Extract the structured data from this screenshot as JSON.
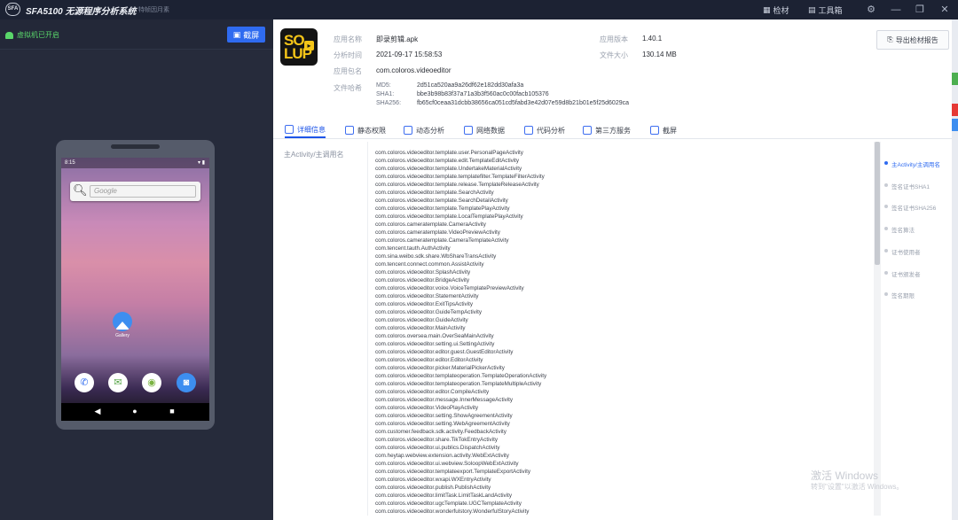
{
  "titlebar": {
    "logo_text": "SFA",
    "title": "SFA5100 无源程序分析系统",
    "subtitle": "特帧因月素",
    "btn_check": "检材",
    "btn_toolbox": "工具箱"
  },
  "emulator": {
    "status": "虚拟机已开启",
    "screenshot_btn": "截屏",
    "phone": {
      "time": "8:15",
      "search_placeholder": "Google",
      "gallery_label": "Gallery"
    }
  },
  "app_info": {
    "icon_text": "SO LUP",
    "name_label": "应用名称",
    "name": "即录剪辑.apk",
    "time_label": "分析时间",
    "time": "2021-09-17 15:58:53",
    "package_label": "应用包名",
    "package": "com.coloros.videoeditor",
    "version_label": "应用版本",
    "version": "1.40.1",
    "size_label": "文件大小",
    "size": "130.14 MB",
    "hash_label": "文件哈希",
    "md5_label": "MD5:",
    "md5": "2d51ca520aa9a26df62e182dd30afa3a",
    "sha1_label": "SHA1:",
    "sha1": "bbe3b98b83f37a71a3b3f560ac0c00facb105376",
    "sha256_label": "SHA256:",
    "sha256": "fb65cf0ceaa31dcbb38656ca051cd5fabd3e42d07e59d8b21b01e5f25d6029ca",
    "export_btn": "导出检材报告"
  },
  "tabs": [
    "详细信息",
    "静态权限",
    "动态分析",
    "网络数据",
    "代码分析",
    "第三方服务",
    "截屏"
  ],
  "detail": {
    "side_label": "主Activity/主调用名",
    "activities": [
      "com.coloros.videoeditor.template.user.PersonalPageActivity",
      "com.coloros.videoeditor.template.edit.TemplateEditActivity",
      "com.coloros.videoeditor.template.UndertakeMaterialActivity",
      "com.coloros.videoeditor.template.templatefilter.TemplateFilterActivity",
      "com.coloros.videoeditor.template.release.TemplateReleaseActivity",
      "com.coloros.videoeditor.template.SearchActivity",
      "com.coloros.videoeditor.template.SearchDetailActivity",
      "com.coloros.videoeditor.template.TemplatePlayActivity",
      "com.coloros.videoeditor.template.LocalTemplatePlayActivity",
      "com.coloros.cameratemplate.CameraActivity",
      "com.coloros.cameratemplate.VideoPreviewActivity",
      "com.coloros.cameratemplate.CameraTemplateActivity",
      "com.tencent.tauth.AuthActivity",
      "com.sina.weibo.sdk.share.WbShareTransActivity",
      "com.tencent.connect.common.AssistActivity",
      "com.coloros.videoeditor.SplashActivity",
      "com.coloros.videoeditor.BridgeActivity",
      "com.coloros.videoeditor.voice.VoiceTemplatePreviewActivity",
      "com.coloros.videoeditor.StatementActivity",
      "com.coloros.videoeditor.ExitTipsActivity",
      "com.coloros.videoeditor.GuideTempActivity",
      "com.coloros.videoeditor.GuideActivity",
      "com.coloros.videoeditor.MainActivity",
      "com.coloros.oversea.main.OverSeaMainActivity",
      "com.coloros.videoeditor.setting.ui.SettingActivity",
      "com.coloros.videoeditor.editor.guest.GuestEditorActivity",
      "com.coloros.videoeditor.editor.EditorActivity",
      "com.coloros.videoeditor.picker.MaterialPickerActivity",
      "com.coloros.videoeditor.templateoperation.TemplateOperationActivity",
      "com.coloros.videoeditor.templateoperation.TemplateMultipleActivity",
      "com.coloros.videoeditor.editor.CompileActivity",
      "com.coloros.videoeditor.message.InnerMessageActivity",
      "com.coloros.videoeditor.VideoPlayActivity",
      "com.coloros.videoeditor.setting.ShowAgreementActivity",
      "com.coloros.videoeditor.setting.WebAgreementActivity",
      "com.customer.feedback.sdk.activity.FeedbackActivity",
      "com.coloros.videoeditor.share.TikTokEntryActivity",
      "com.coloros.videoeditor.ui.publics.DispatchActivity",
      "com.heytap.webview.extension.activity.WebExtActivity",
      "com.coloros.videoeditor.ui.webview.SoloopWebExtActivity",
      "com.coloros.videoeditor.templateexport.TemplateExportActivity",
      "com.coloros.videoeditor.wxapi.WXEntryActivity",
      "com.coloros.videoeditor.publish.PublishActivity",
      "com.coloros.videoeditor.limitTask.LimitTaskLandActivity",
      "com.coloros.videoeditor.ugcTemplate.UGCTemplateActivity",
      "com.coloros.videoeditor.wonderfulstory.WonderfulStoryActivity"
    ],
    "anchors": [
      "主Activity/主调用名",
      "签名证书SHA1",
      "签名证书SHA256",
      "签名算法",
      "证书使用者",
      "证书颁发者",
      "签名期限"
    ]
  },
  "watermark": {
    "line1": "激活 Windows",
    "line2": "转到\"设置\"以激活 Windows。"
  },
  "colors": {
    "accent": "#2f6bf0",
    "success": "#59d66a",
    "dark_bg": "#1f2433"
  }
}
